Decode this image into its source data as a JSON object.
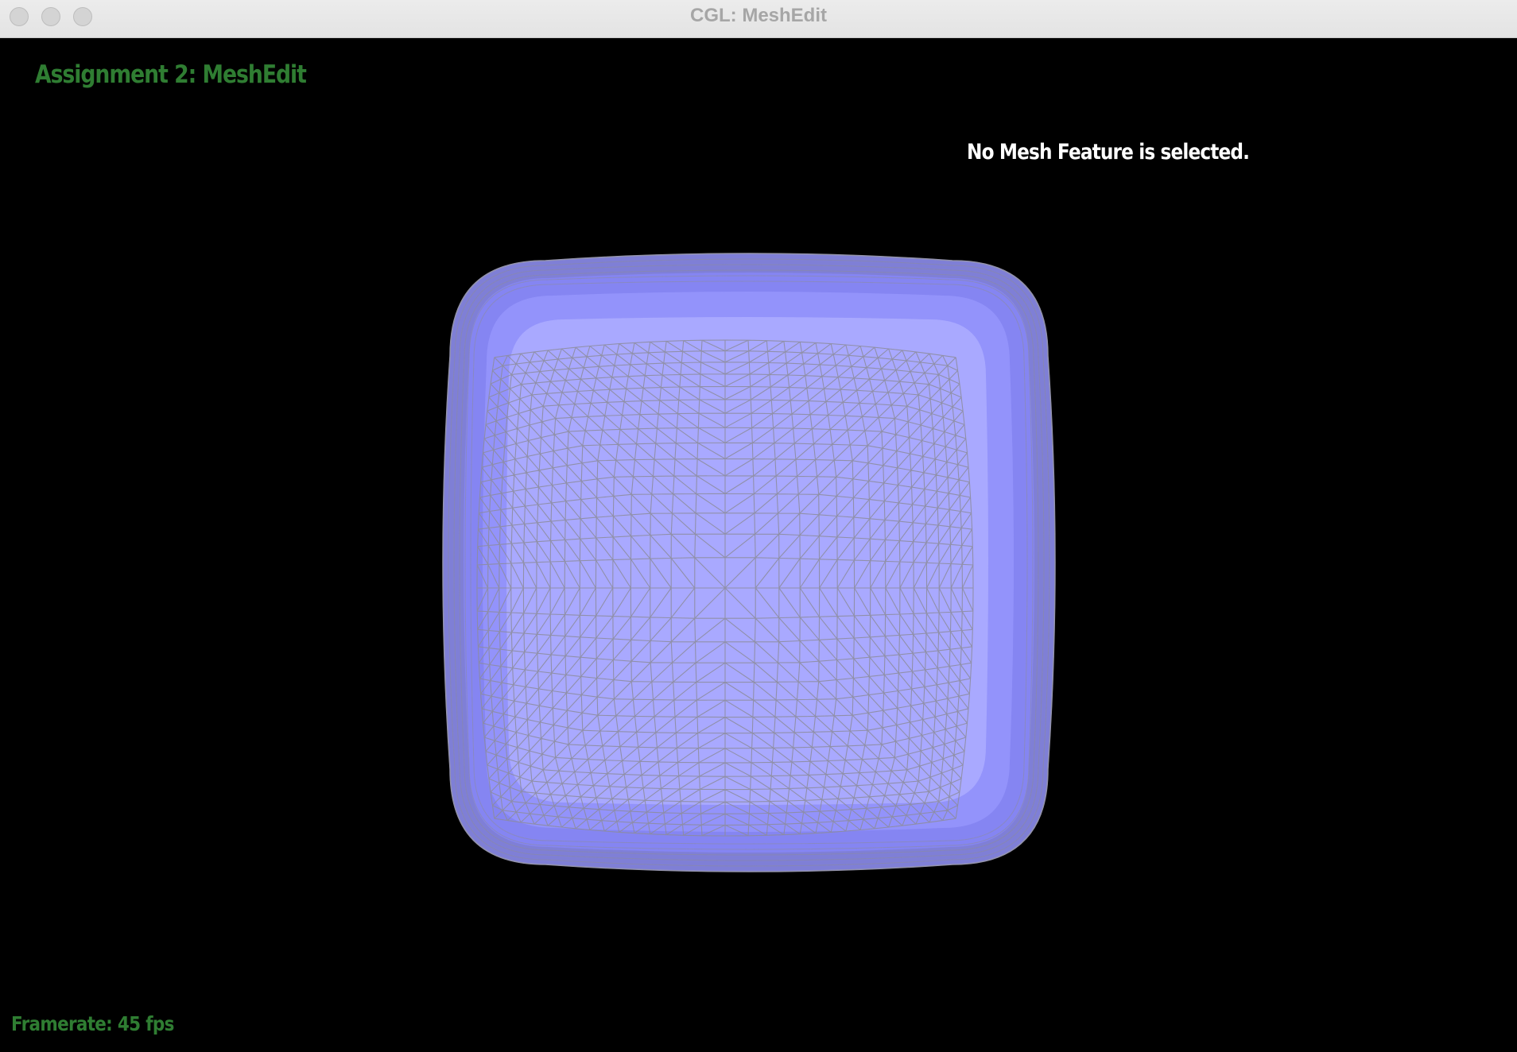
{
  "window": {
    "title": "CGL: MeshEdit"
  },
  "overlay": {
    "app_title": "Assignment 2: MeshEdit",
    "selection_status": "No Mesh Feature is selected.",
    "framerate_label": "Framerate: 45 fps"
  },
  "colors": {
    "background": "#000000",
    "accent_green": "#2f7d32",
    "status_white": "#ffffff",
    "mesh_fill": "#a9a9ff",
    "mesh_edge": "#8c8c9a",
    "titlebar": "#e8e8e8"
  },
  "icons": {
    "window_controls": [
      "close-icon",
      "minimize-icon",
      "maximize-icon"
    ]
  },
  "mesh": {
    "shape": "rounded cube",
    "display": "wireframe over shaded faces",
    "selected_feature": "none"
  }
}
